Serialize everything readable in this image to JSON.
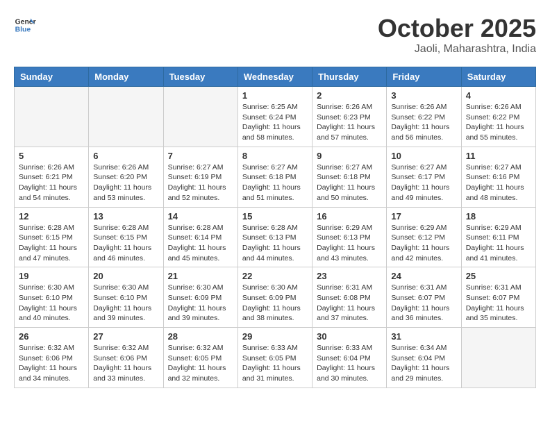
{
  "header": {
    "logo_line1": "General",
    "logo_line2": "Blue",
    "month": "October 2025",
    "location": "Jaoli, Maharashtra, India"
  },
  "weekdays": [
    "Sunday",
    "Monday",
    "Tuesday",
    "Wednesday",
    "Thursday",
    "Friday",
    "Saturday"
  ],
  "weeks": [
    [
      {
        "day": "",
        "info": ""
      },
      {
        "day": "",
        "info": ""
      },
      {
        "day": "",
        "info": ""
      },
      {
        "day": "1",
        "info": "Sunrise: 6:25 AM\nSunset: 6:24 PM\nDaylight: 11 hours\nand 58 minutes."
      },
      {
        "day": "2",
        "info": "Sunrise: 6:26 AM\nSunset: 6:23 PM\nDaylight: 11 hours\nand 57 minutes."
      },
      {
        "day": "3",
        "info": "Sunrise: 6:26 AM\nSunset: 6:22 PM\nDaylight: 11 hours\nand 56 minutes."
      },
      {
        "day": "4",
        "info": "Sunrise: 6:26 AM\nSunset: 6:22 PM\nDaylight: 11 hours\nand 55 minutes."
      }
    ],
    [
      {
        "day": "5",
        "info": "Sunrise: 6:26 AM\nSunset: 6:21 PM\nDaylight: 11 hours\nand 54 minutes."
      },
      {
        "day": "6",
        "info": "Sunrise: 6:26 AM\nSunset: 6:20 PM\nDaylight: 11 hours\nand 53 minutes."
      },
      {
        "day": "7",
        "info": "Sunrise: 6:27 AM\nSunset: 6:19 PM\nDaylight: 11 hours\nand 52 minutes."
      },
      {
        "day": "8",
        "info": "Sunrise: 6:27 AM\nSunset: 6:18 PM\nDaylight: 11 hours\nand 51 minutes."
      },
      {
        "day": "9",
        "info": "Sunrise: 6:27 AM\nSunset: 6:18 PM\nDaylight: 11 hours\nand 50 minutes."
      },
      {
        "day": "10",
        "info": "Sunrise: 6:27 AM\nSunset: 6:17 PM\nDaylight: 11 hours\nand 49 minutes."
      },
      {
        "day": "11",
        "info": "Sunrise: 6:27 AM\nSunset: 6:16 PM\nDaylight: 11 hours\nand 48 minutes."
      }
    ],
    [
      {
        "day": "12",
        "info": "Sunrise: 6:28 AM\nSunset: 6:15 PM\nDaylight: 11 hours\nand 47 minutes."
      },
      {
        "day": "13",
        "info": "Sunrise: 6:28 AM\nSunset: 6:15 PM\nDaylight: 11 hours\nand 46 minutes."
      },
      {
        "day": "14",
        "info": "Sunrise: 6:28 AM\nSunset: 6:14 PM\nDaylight: 11 hours\nand 45 minutes."
      },
      {
        "day": "15",
        "info": "Sunrise: 6:28 AM\nSunset: 6:13 PM\nDaylight: 11 hours\nand 44 minutes."
      },
      {
        "day": "16",
        "info": "Sunrise: 6:29 AM\nSunset: 6:13 PM\nDaylight: 11 hours\nand 43 minutes."
      },
      {
        "day": "17",
        "info": "Sunrise: 6:29 AM\nSunset: 6:12 PM\nDaylight: 11 hours\nand 42 minutes."
      },
      {
        "day": "18",
        "info": "Sunrise: 6:29 AM\nSunset: 6:11 PM\nDaylight: 11 hours\nand 41 minutes."
      }
    ],
    [
      {
        "day": "19",
        "info": "Sunrise: 6:30 AM\nSunset: 6:10 PM\nDaylight: 11 hours\nand 40 minutes."
      },
      {
        "day": "20",
        "info": "Sunrise: 6:30 AM\nSunset: 6:10 PM\nDaylight: 11 hours\nand 39 minutes."
      },
      {
        "day": "21",
        "info": "Sunrise: 6:30 AM\nSunset: 6:09 PM\nDaylight: 11 hours\nand 39 minutes."
      },
      {
        "day": "22",
        "info": "Sunrise: 6:30 AM\nSunset: 6:09 PM\nDaylight: 11 hours\nand 38 minutes."
      },
      {
        "day": "23",
        "info": "Sunrise: 6:31 AM\nSunset: 6:08 PM\nDaylight: 11 hours\nand 37 minutes."
      },
      {
        "day": "24",
        "info": "Sunrise: 6:31 AM\nSunset: 6:07 PM\nDaylight: 11 hours\nand 36 minutes."
      },
      {
        "day": "25",
        "info": "Sunrise: 6:31 AM\nSunset: 6:07 PM\nDaylight: 11 hours\nand 35 minutes."
      }
    ],
    [
      {
        "day": "26",
        "info": "Sunrise: 6:32 AM\nSunset: 6:06 PM\nDaylight: 11 hours\nand 34 minutes."
      },
      {
        "day": "27",
        "info": "Sunrise: 6:32 AM\nSunset: 6:06 PM\nDaylight: 11 hours\nand 33 minutes."
      },
      {
        "day": "28",
        "info": "Sunrise: 6:32 AM\nSunset: 6:05 PM\nDaylight: 11 hours\nand 32 minutes."
      },
      {
        "day": "29",
        "info": "Sunrise: 6:33 AM\nSunset: 6:05 PM\nDaylight: 11 hours\nand 31 minutes."
      },
      {
        "day": "30",
        "info": "Sunrise: 6:33 AM\nSunset: 6:04 PM\nDaylight: 11 hours\nand 30 minutes."
      },
      {
        "day": "31",
        "info": "Sunrise: 6:34 AM\nSunset: 6:04 PM\nDaylight: 11 hours\nand 29 minutes."
      },
      {
        "day": "",
        "info": ""
      }
    ]
  ]
}
